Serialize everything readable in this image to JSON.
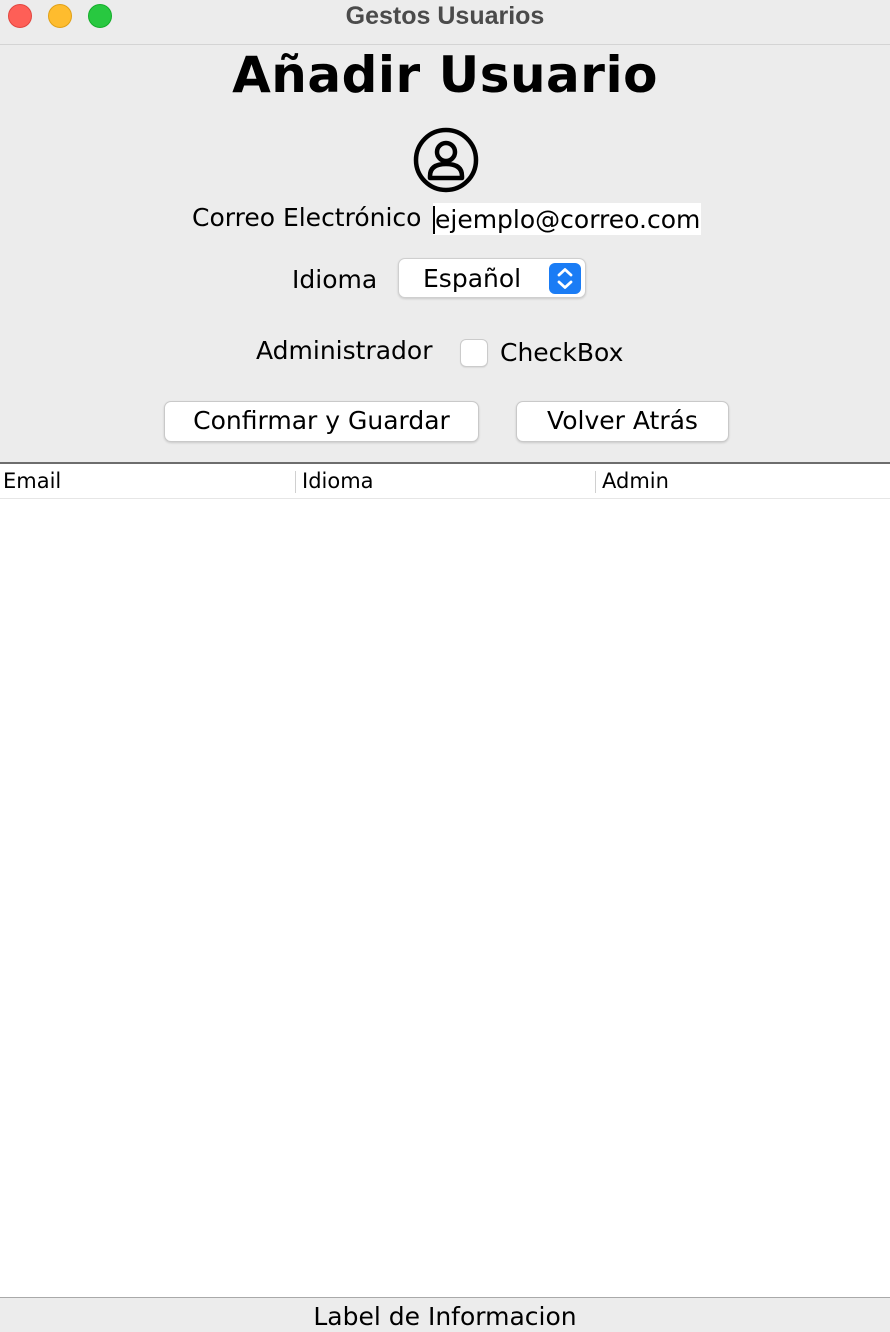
{
  "window": {
    "title": "Gestos Usuarios"
  },
  "form": {
    "heading": "Añadir Usuario",
    "email_label": "Correo Electrónico",
    "email_value": "ejemplo@correo.com",
    "language_label": "Idioma",
    "language_value": "Español",
    "admin_label": "Administrador",
    "admin_checked": false,
    "checkbox_label": "CheckBox",
    "save_button": "Confirmar y Guardar",
    "back_button": "Volver Atrás"
  },
  "table": {
    "columns": [
      "Email",
      "Idioma",
      "Admin"
    ],
    "rows": []
  },
  "status": {
    "info_label": "Label de Informacion"
  },
  "colors": {
    "close": "#fe5f57",
    "minimize": "#febc2e",
    "maximize": "#28c840",
    "select_accent": "#1a7cf5"
  }
}
